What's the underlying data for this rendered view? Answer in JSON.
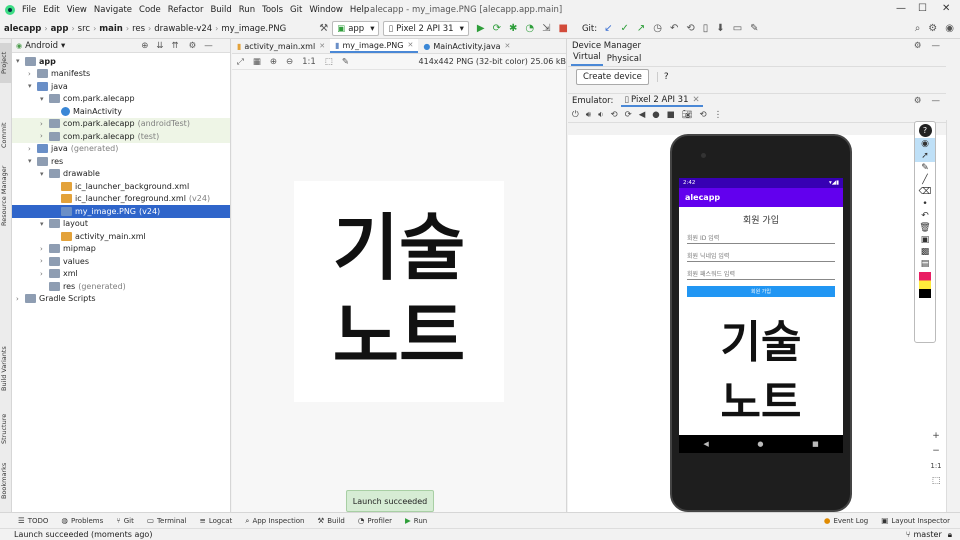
{
  "menu": {
    "items": [
      "File",
      "Edit",
      "View",
      "Navigate",
      "Code",
      "Refactor",
      "Build",
      "Run",
      "Tools",
      "Git",
      "Window",
      "Help"
    ],
    "title": "alecapp - my_image.PNG [alecapp.app.main]"
  },
  "nav": {
    "crumbs": [
      "alecapp",
      "app",
      "src",
      "main",
      "res",
      "drawable-v24",
      "my_image.PNG"
    ],
    "run_config": "app",
    "device": "Pixel 2 API 31",
    "git_label": "Git:"
  },
  "project": {
    "view": "Android",
    "tree": [
      {
        "label": "app",
        "depth": 0,
        "arrow": "▾",
        "icon": "folder",
        "bold": true
      },
      {
        "label": "manifests",
        "depth": 1,
        "arrow": "›",
        "icon": "folder"
      },
      {
        "label": "java",
        "depth": 1,
        "arrow": "▾",
        "icon": "folder-java"
      },
      {
        "label": "com.park.alecapp",
        "depth": 2,
        "arrow": "▾",
        "icon": "folder"
      },
      {
        "label": "MainActivity",
        "depth": 3,
        "arrow": "",
        "icon": "class"
      },
      {
        "label": "com.park.alecapp",
        "suffix": "(androidTest)",
        "depth": 2,
        "arrow": "›",
        "icon": "folder",
        "green": true
      },
      {
        "label": "com.park.alecapp",
        "suffix": "(test)",
        "depth": 2,
        "arrow": "›",
        "icon": "folder",
        "green": true
      },
      {
        "label": "java",
        "suffix": "(generated)",
        "depth": 1,
        "arrow": "›",
        "icon": "folder-java"
      },
      {
        "label": "res",
        "depth": 1,
        "arrow": "▾",
        "icon": "folder-res"
      },
      {
        "label": "drawable",
        "depth": 2,
        "arrow": "▾",
        "icon": "folder"
      },
      {
        "label": "ic_launcher_background.xml",
        "depth": 3,
        "arrow": "",
        "icon": "xml"
      },
      {
        "label": "ic_launcher_foreground.xml",
        "suffix": "(v24)",
        "depth": 3,
        "arrow": "",
        "icon": "xml"
      },
      {
        "label": "my_image.PNG",
        "suffix": "(v24)",
        "depth": 3,
        "arrow": "",
        "icon": "img",
        "selected": true
      },
      {
        "label": "layout",
        "depth": 2,
        "arrow": "▾",
        "icon": "folder"
      },
      {
        "label": "activity_main.xml",
        "depth": 3,
        "arrow": "",
        "icon": "xml"
      },
      {
        "label": "mipmap",
        "depth": 2,
        "arrow": "›",
        "icon": "folder"
      },
      {
        "label": "values",
        "depth": 2,
        "arrow": "›",
        "icon": "folder"
      },
      {
        "label": "xml",
        "depth": 2,
        "arrow": "›",
        "icon": "folder"
      },
      {
        "label": "res",
        "suffix": "(generated)",
        "depth": 2,
        "arrow": "",
        "icon": "folder-res"
      },
      {
        "label": "Gradle Scripts",
        "depth": 0,
        "arrow": "›",
        "icon": "gradle"
      }
    ]
  },
  "left_tabs": [
    "Project",
    "Commit",
    "Resource Manager",
    "Build Variants",
    "Structure",
    "Bookmarks"
  ],
  "editor": {
    "tabs": [
      {
        "label": "activity_main.xml",
        "active": false
      },
      {
        "label": "my_image.PNG",
        "active": true
      },
      {
        "label": "MainActivity.java",
        "active": false
      }
    ],
    "image_info": "414x442 PNG (32-bit color) 25.06 kB",
    "zoom_ratio": "1:1",
    "image_text_line1": "기술",
    "image_text_line2": "노트"
  },
  "device_manager": {
    "title": "Device Manager",
    "tabs": [
      "Virtual",
      "Physical"
    ],
    "create_button": "Create device",
    "help": "?"
  },
  "emulator": {
    "label": "Emulator:",
    "tab": "Pixel 2 API 31",
    "zoom_ratio": "1:1"
  },
  "phone": {
    "time": "2:42",
    "app_title": "alecapp",
    "heading": "회원 가입",
    "fields": [
      "회원 ID 입력",
      "회원 닉네임 입력",
      "회원 패스워드 입력"
    ],
    "button": "회원 가입",
    "image_line1": "기술",
    "image_line2": "노트"
  },
  "bottom": {
    "tools": [
      "TODO",
      "Problems",
      "Git",
      "Terminal",
      "Logcat",
      "App Inspection",
      "Build",
      "Profiler",
      "Run"
    ],
    "right_tools": [
      "Event Log",
      "Layout Inspector"
    ],
    "status": "Launch succeeded (moments ago)",
    "branch": "master",
    "toast": "Launch succeeded"
  }
}
